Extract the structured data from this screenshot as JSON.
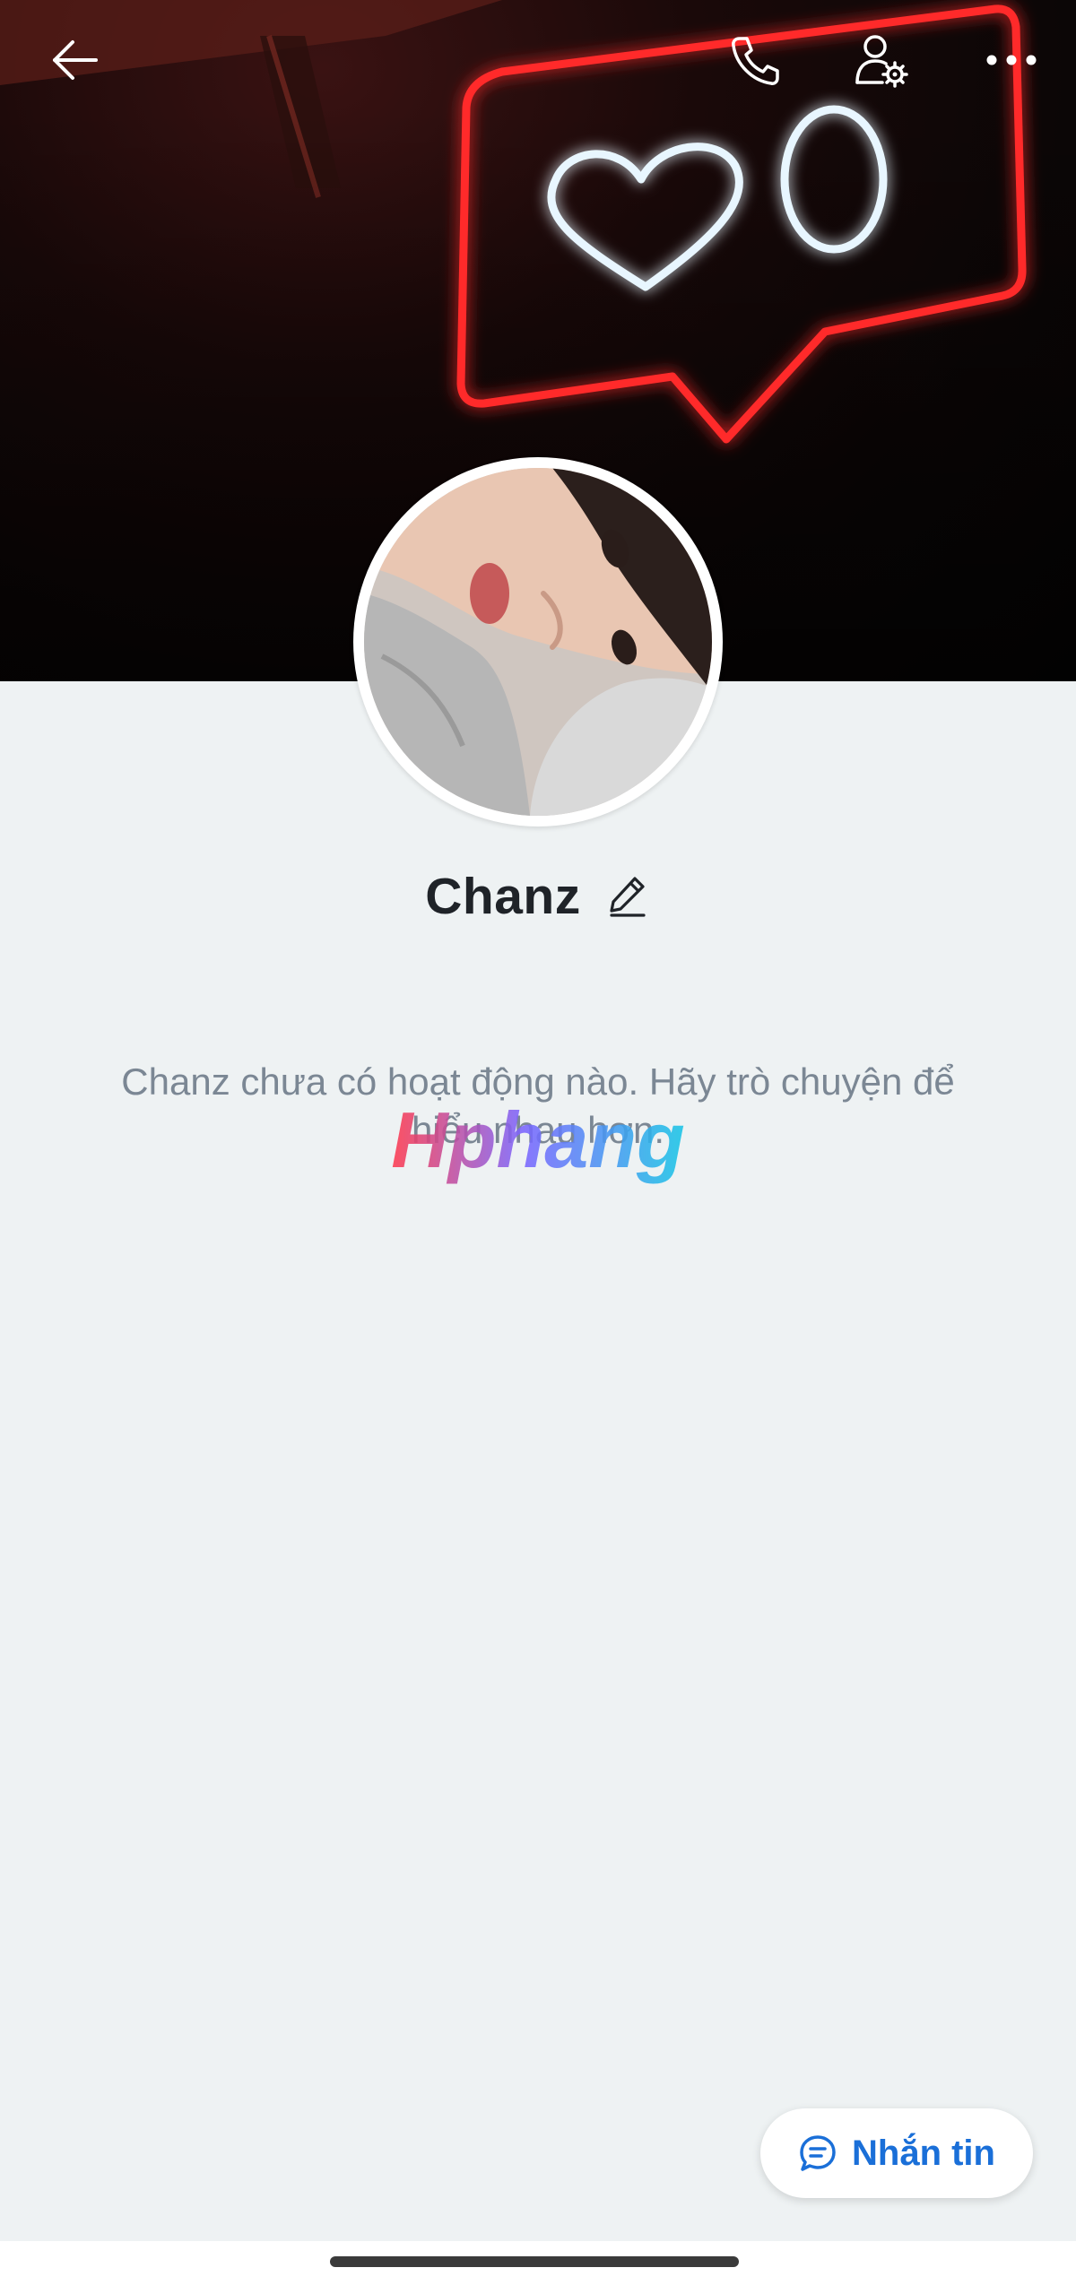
{
  "topbar": {
    "back_icon": "arrow-left-icon",
    "call_icon": "phone-icon",
    "settings_icon": "user-settings-icon",
    "more_icon": "more-horizontal-icon"
  },
  "profile": {
    "name": "Chanz",
    "edit_icon": "pencil-icon"
  },
  "empty_state": {
    "message": "Chanz chưa có hoạt động nào. Hãy trò chuyện để hiểu nhau hơn."
  },
  "watermark": {
    "text": "Hphang"
  },
  "actions": {
    "message_label": "Nhắn tin",
    "message_icon": "chat-bubble-icon"
  },
  "colors": {
    "page_background": "#eef2f3",
    "accent": "#1a6fd8",
    "neon_red": "#ff2a2a",
    "neon_white": "#e8f6ff"
  }
}
